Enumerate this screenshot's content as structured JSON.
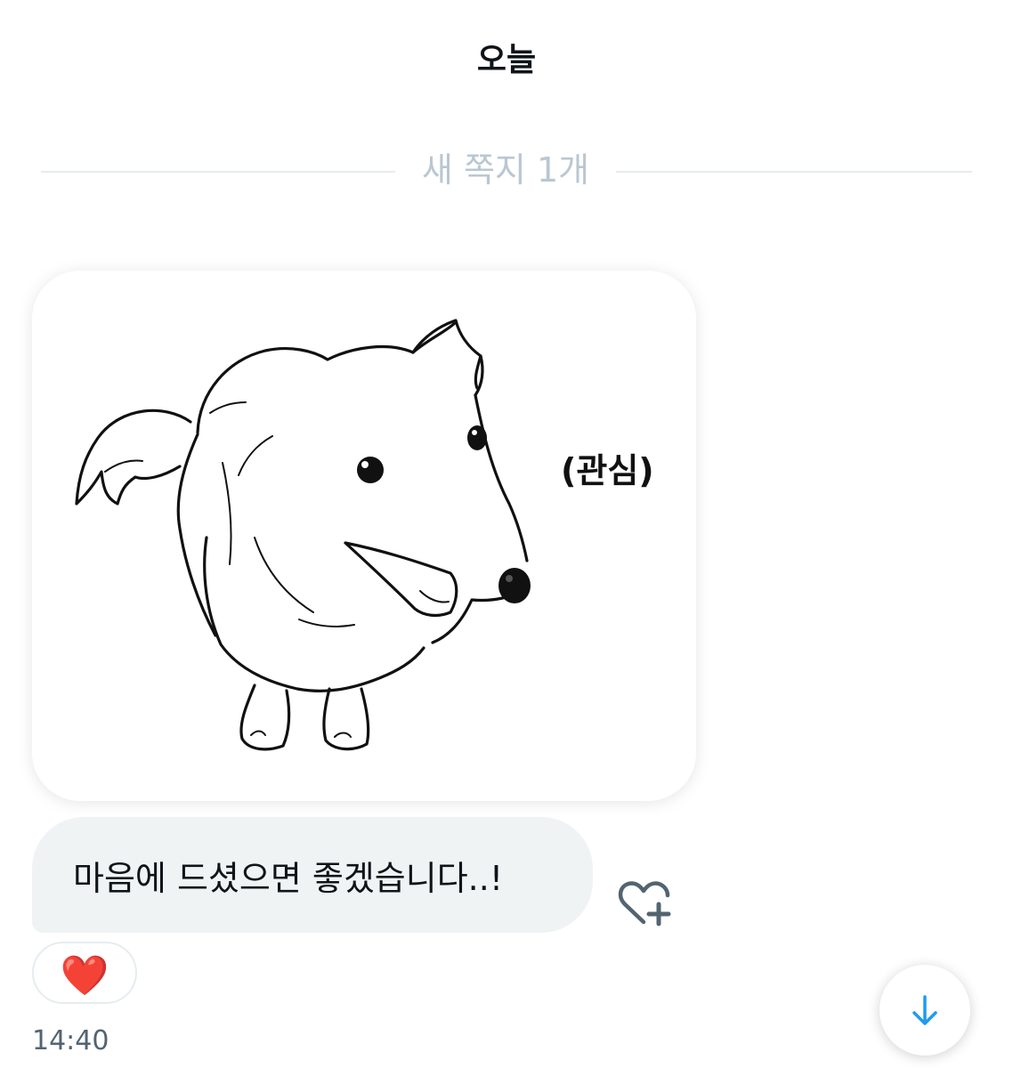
{
  "conversation": {
    "date_header": "오늘",
    "divider_label": "새 쪽지 1개"
  },
  "message": {
    "image_caption": "(관심)",
    "image_subject": "dog-illustration",
    "text": "마음에 드셨으면 좋겠습니다..!",
    "reaction": "❤️",
    "timestamp": "14:40"
  },
  "icons": {
    "react": "heart-plus-icon",
    "scroll": "arrow-down-icon"
  },
  "colors": {
    "bubble_bg": "#eff3f4",
    "divider_text": "#b9c7d2",
    "accent": "#1d9bf0",
    "heart": "#e0245e"
  }
}
